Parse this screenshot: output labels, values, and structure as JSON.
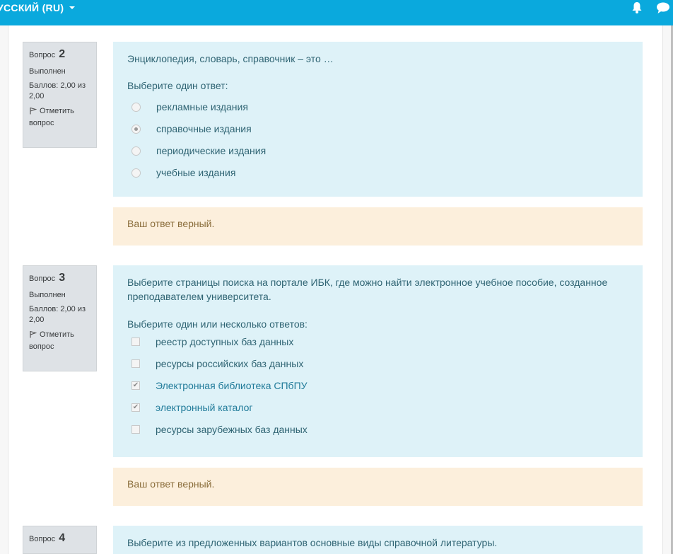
{
  "navbar": {
    "language": "УССКИЙ (RU)",
    "icons": [
      "bell-icon",
      "chat-icon"
    ],
    "bg_color": "#0aa9dd"
  },
  "questions": [
    {
      "label": "Вопрос",
      "number": "2",
      "state": "Выполнен",
      "grade": "Баллов: 2,00 из 2,00",
      "flag": "Отметить вопрос",
      "text": "Энциклопедия, словарь, справочник – это …",
      "prompt": "Выберите один ответ:",
      "type": "radio",
      "options": [
        {
          "label": "рекламные издания",
          "selected": false
        },
        {
          "label": "справочные издания",
          "selected": true
        },
        {
          "label": "периодические издания",
          "selected": false
        },
        {
          "label": "учебные издания",
          "selected": false
        }
      ],
      "feedback": "Ваш ответ верный."
    },
    {
      "label": "Вопрос",
      "number": "3",
      "state": "Выполнен",
      "grade": "Баллов: 2,00 из 2,00",
      "flag": "Отметить вопрос",
      "text": "Выберите страницы поиска на портале ИБК, где можно найти электронное учебное пособие, созданное преподавателем университета.",
      "prompt": "Выберите один или несколько ответов:",
      "type": "checkbox",
      "options": [
        {
          "label": "реестр доступных баз данных",
          "selected": false
        },
        {
          "label": "ресурсы российских баз данных",
          "selected": false
        },
        {
          "label": "Электронная библиотека СПбПУ",
          "selected": true
        },
        {
          "label": "электронный каталог",
          "selected": true
        },
        {
          "label": "ресурсы зарубежных баз данных",
          "selected": false
        }
      ],
      "feedback": "Ваш ответ верный."
    },
    {
      "label": "Вопрос",
      "number": "4",
      "text": "Выберите из предложенных вариантов основные виды справочной литературы."
    }
  ]
}
